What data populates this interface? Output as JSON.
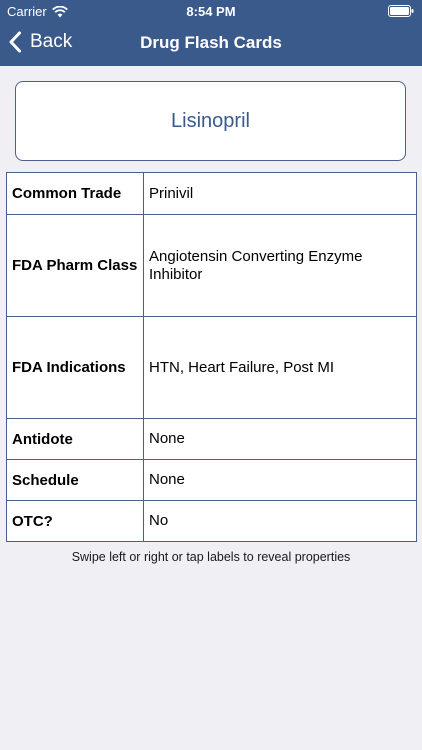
{
  "status_bar": {
    "carrier": "Carrier",
    "time": "8:54 PM"
  },
  "nav": {
    "back_label": "Back",
    "title": "Drug Flash Cards"
  },
  "card": {
    "drug_name": "Lisinopril"
  },
  "properties": [
    {
      "label": "Common Trade",
      "value": "Prinivil"
    },
    {
      "label": "FDA Pharm Class",
      "value": "Angiotensin Converting Enzyme Inhibitor"
    },
    {
      "label": "FDA Indications",
      "value": "HTN, Heart Failure, Post MI"
    },
    {
      "label": "Antidote",
      "value": "None"
    },
    {
      "label": "Schedule",
      "value": "None"
    },
    {
      "label": "OTC?",
      "value": "No"
    }
  ],
  "hint": "Swipe left or right or tap labels to reveal properties",
  "colors": {
    "nav_background": "#3b5a8c",
    "page_background": "#efeff4",
    "accent_text": "#3b5a8c",
    "border": "#4a5f8a"
  },
  "icons": {
    "wifi": "wifi-icon",
    "battery": "battery-icon",
    "back": "back-chevron-icon"
  }
}
